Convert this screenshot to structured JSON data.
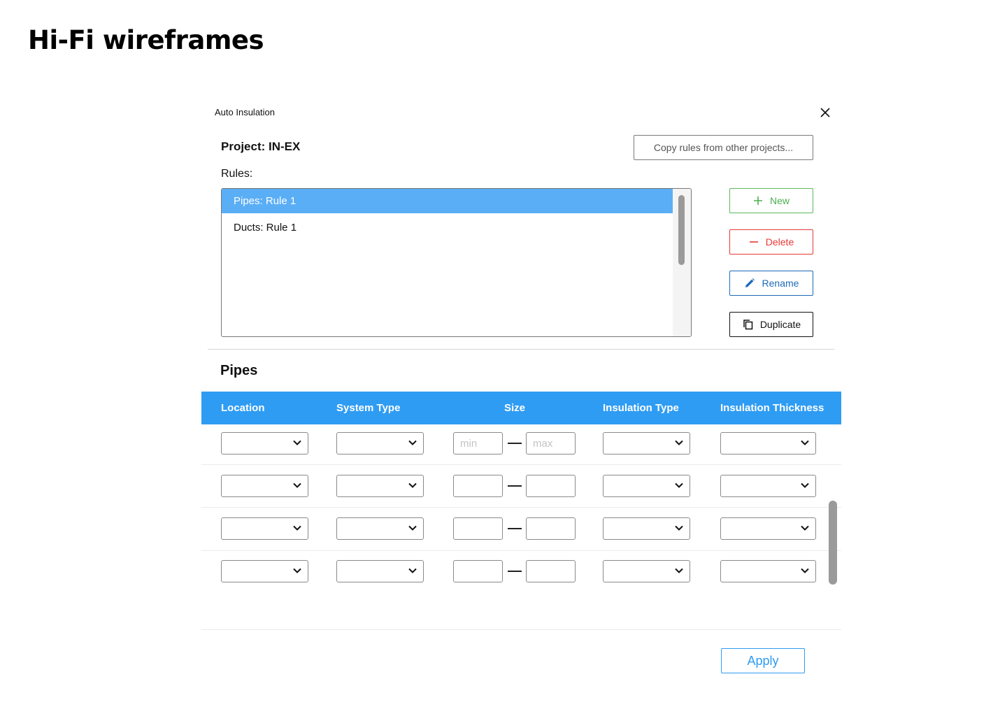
{
  "page": {
    "title": "Hi-Fi wireframes"
  },
  "dialog": {
    "title": "Auto Insulation",
    "close_icon": "close-icon",
    "project_label": "Project: IN-EX",
    "copy_rules_label": "Copy rules from other projects...",
    "rules_label": "Rules:",
    "rules": [
      {
        "label": "Pipes: Rule 1",
        "selected": true
      },
      {
        "label": "Ducts: Rule 1",
        "selected": false
      }
    ],
    "actions": {
      "new_label": "New",
      "delete_label": "Delete",
      "rename_label": "Rename",
      "duplicate_label": "Duplicate"
    },
    "section_title": "Pipes",
    "table": {
      "columns": [
        "Location",
        "System Type",
        "Size",
        "Insulation Type",
        "Insulation Thickness"
      ],
      "size_placeholders": {
        "min": "min",
        "max": "max"
      },
      "rows": [
        {
          "location": "",
          "system_type": "",
          "size_min": "",
          "size_max": "",
          "insulation_type": "",
          "insulation_thickness": ""
        },
        {
          "location": "",
          "system_type": "",
          "size_min": "",
          "size_max": "",
          "insulation_type": "",
          "insulation_thickness": ""
        },
        {
          "location": "",
          "system_type": "",
          "size_min": "",
          "size_max": "",
          "insulation_type": "",
          "insulation_thickness": ""
        },
        {
          "location": "",
          "system_type": "",
          "size_min": "",
          "size_max": "",
          "insulation_type": "",
          "insulation_thickness": ""
        }
      ]
    },
    "apply_label": "Apply"
  },
  "colors": {
    "accent": "#2f9cf3",
    "selected_rule": "#5aaef5",
    "new": "#4caf50",
    "delete": "#e53935",
    "rename": "#1e6bb8"
  }
}
